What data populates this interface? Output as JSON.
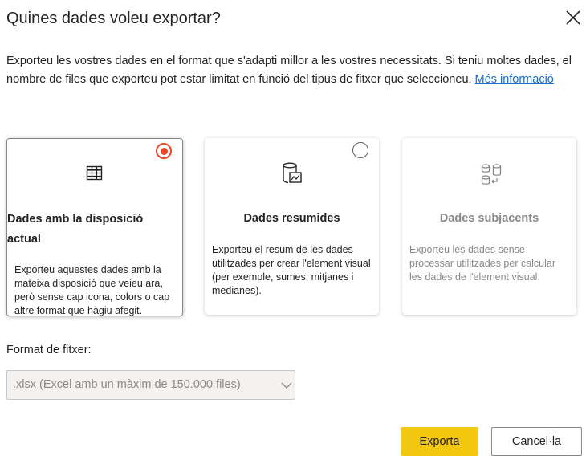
{
  "dialog": {
    "title": "Quines dades voleu exportar?",
    "intro": "Exporteu les vostres dades en el format que s'adapti millor a les vostres necessitats. Si teniu moltes dades, el nombre de files que exporteu pot estar limitat en funció del tipus de fitxer que seleccioneu.",
    "more_info": "Més informació"
  },
  "options": [
    {
      "title": "Dades amb la disposició actual",
      "description": "Exporteu aquestes dades amb la mateixa disposició que veieu ara, però sense cap icona, colors o cap altre format que hàgiu afegit.",
      "icon": "table-icon",
      "selected": true,
      "enabled": true
    },
    {
      "title": "Dades resumides",
      "description": "Exporteu el resum de les dades utilitzades per crear l'element visual (per exemple, sumes, mitjanes i medianes).",
      "icon": "summarized-data-icon",
      "selected": false,
      "enabled": true
    },
    {
      "title": "Dades subjacents",
      "description": "Exporteu les dades sense processar utilitzades per calcular les dades de l'element visual.",
      "icon": "underlying-data-icon",
      "selected": false,
      "enabled": false
    }
  ],
  "format": {
    "label": "Format de fitxer:",
    "selected": ".xlsx (Excel amb un màxim de 150.000 files)"
  },
  "buttons": {
    "export": "Exporta",
    "cancel": "Cancel·la"
  },
  "colors": {
    "accent": "#f2c811",
    "radio_selected": "#e8482a",
    "link": "#1a6ec9"
  }
}
